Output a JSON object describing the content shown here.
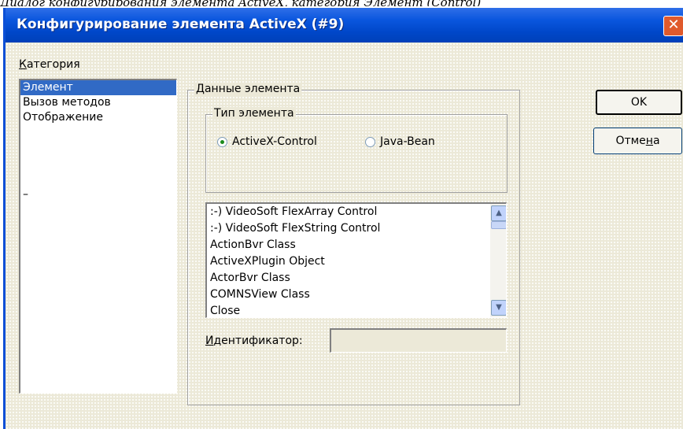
{
  "caption": "Диалог конфигурирования элемента ActiveX, категория Элемент (Control)",
  "window": {
    "title": "Конфигурирование элемента ActiveX (#9)",
    "close_glyph": "✕"
  },
  "category": {
    "label_u": "К",
    "label_rest": "атегория",
    "items": [
      "Элемент",
      "Вызов методов",
      "Отображение"
    ],
    "selected": 0,
    "extra_mark": "–"
  },
  "element_data": {
    "title": "Данные элемента",
    "element_type": {
      "title": "Тип элемента",
      "options": [
        {
          "label": "ActiveX-Control",
          "checked": true
        },
        {
          "label": "Java-Bean",
          "checked": false
        }
      ]
    },
    "controls": [
      ":-) VideoSoft FlexArray Control",
      ":-) VideoSoft FlexString Control",
      "ActionBvr Class",
      "ActiveXPlugin Object",
      "ActorBvr Class",
      "COMNSView Class",
      "Close"
    ],
    "identifier": {
      "label_u": "И",
      "label_rest": "дентификатор:",
      "value": ""
    }
  },
  "buttons": {
    "ok": "OK",
    "cancel_pre": "Отме",
    "cancel_u": "н",
    "cancel_post": "а"
  },
  "icons": {
    "scroll_up": "▲",
    "scroll_down": "▼"
  }
}
